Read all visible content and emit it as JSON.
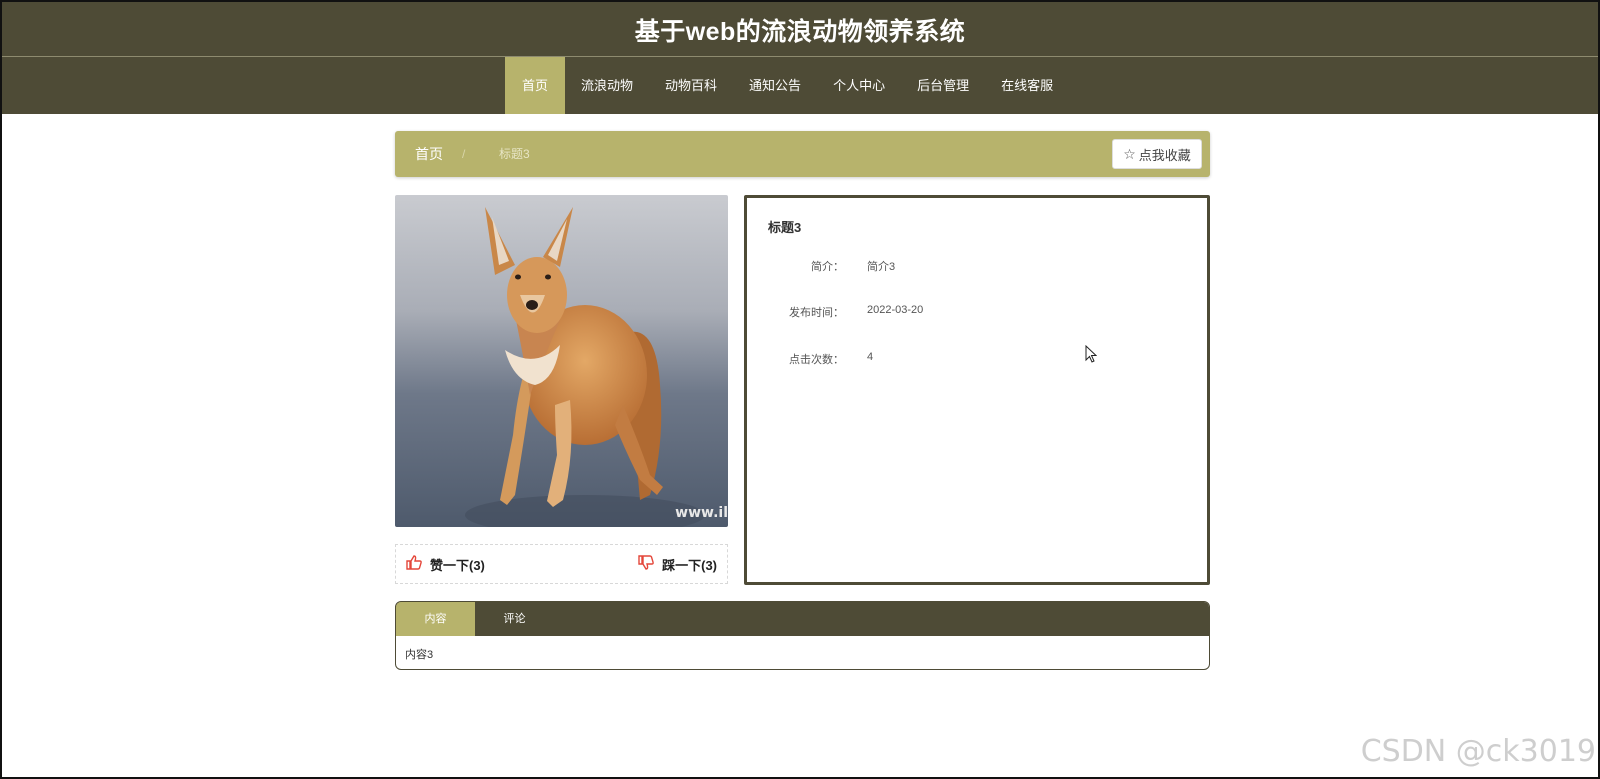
{
  "header": {
    "title": "基于web的流浪动物领养系统",
    "nav": [
      {
        "label": "首页",
        "active": true
      },
      {
        "label": "流浪动物",
        "active": false
      },
      {
        "label": "动物百科",
        "active": false
      },
      {
        "label": "通知公告",
        "active": false
      },
      {
        "label": "个人中心",
        "active": false
      },
      {
        "label": "后台管理",
        "active": false
      },
      {
        "label": "在线客服",
        "active": false
      }
    ]
  },
  "breadcrumb": {
    "home": "首页",
    "separator": "/",
    "current": "标题3",
    "favorite_label": "点我收藏",
    "favorite_icon": "star-outline-icon"
  },
  "media": {
    "image_watermark": "www.il"
  },
  "votes": {
    "like_label": "赞一下(3)",
    "dislike_label": "踩一下(3)",
    "like_icon": "thumbs-up-icon",
    "dislike_icon": "thumbs-down-icon"
  },
  "detail": {
    "title": "标题3",
    "rows": [
      {
        "label": "简介：",
        "value": "简介3"
      },
      {
        "label": "发布时间：",
        "value": "2022-03-20"
      },
      {
        "label": "点击次数：",
        "value": "4"
      }
    ]
  },
  "tabs": {
    "items": [
      {
        "label": "内容",
        "active": true
      },
      {
        "label": "评论",
        "active": false
      }
    ],
    "content": "内容3"
  },
  "watermark": "CSDN @ck3019",
  "colors": {
    "header_bg": "#4e4b36",
    "accent": "#b7b36c",
    "vote_icon": "#e4463a"
  }
}
